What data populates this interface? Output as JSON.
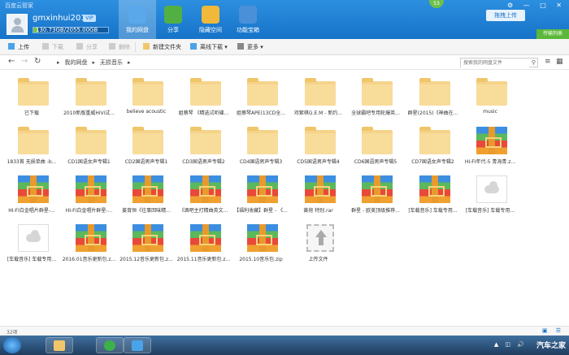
{
  "app": {
    "title": "百度云管家"
  },
  "user": {
    "name": "gmxinhui2014",
    "vip": "VIP",
    "quota_text": "130.73GB/2055.00GB",
    "quota_used": 0.0636
  },
  "nav": [
    {
      "label": "我的网盘",
      "color": "#5aa7ea",
      "active": true
    },
    {
      "label": "分享",
      "color": "#52b043",
      "active": false
    },
    {
      "label": "隐藏空间",
      "color": "#f0b93a",
      "active": false
    },
    {
      "label": "功能宝箱",
      "color": "#4a90d9",
      "active": false
    }
  ],
  "update_badge": "53",
  "drag_upload": "拖拽上传",
  "transfer_list": "传输列表",
  "toolbar": {
    "upload": "上传",
    "download": "下载",
    "share": "分享",
    "delete": "删除",
    "new_folder": "新建文件夹",
    "offline_download": "离线下载",
    "more": "更多"
  },
  "breadcrumb": [
    "我的网盘",
    "无损音乐"
  ],
  "search": {
    "placeholder": "搜索我的网盘文件"
  },
  "files": [
    {
      "name": "已下载",
      "type": "folder"
    },
    {
      "name": "2010新版重威HiVi试...",
      "type": "folder"
    },
    {
      "name": "believe acoustic",
      "type": "folder"
    },
    {
      "name": "姐蔡琴 《精选试听碟...",
      "type": "folder"
    },
    {
      "name": "姐蔡琴APE(13CD全...",
      "type": "folder"
    },
    {
      "name": "邓紫棋G.E.M - 新约...",
      "type": "folder"
    },
    {
      "name": "全球霸吧专用轮爆英...",
      "type": "folder"
    },
    {
      "name": "群星(2015)《神曲在...",
      "type": "folder"
    },
    {
      "name": "music",
      "type": "folder"
    },
    {
      "name": "1833首 无损单曲 -b...",
      "type": "folder"
    },
    {
      "name": "CD1国语女声专辑1",
      "type": "folder"
    },
    {
      "name": "CD2国语男声专辑1",
      "type": "folder"
    },
    {
      "name": "CD3国语男声专辑2",
      "type": "folder"
    },
    {
      "name": "CD4国语男声专辑3",
      "type": "folder"
    },
    {
      "name": "CD5国语男声专辑4",
      "type": "folder"
    },
    {
      "name": "CD6国语男声专辑5",
      "type": "folder"
    },
    {
      "name": "CD7国语女声专辑2",
      "type": "folder"
    },
    {
      "name": "HI-FI年代-5 青海青.z...",
      "type": "rar"
    },
    {
      "name": "HI-FI白金唱片群星-...",
      "type": "rar"
    },
    {
      "name": "HI-FI白金唱片群星-...",
      "type": "rar"
    },
    {
      "name": "姜育恒《往事回味精...",
      "type": "rar"
    },
    {
      "name": "《酒吧主打精曲英文...",
      "type": "rar"
    },
    {
      "name": "【福利收藏】群星 - 《...",
      "type": "rar"
    },
    {
      "name": "黄袍  特别.rar",
      "type": "rar"
    },
    {
      "name": "群星 - 欧美顶级推荐...",
      "type": "rar"
    },
    {
      "name": "[车载音乐] 车载专用...",
      "type": "rar"
    },
    {
      "name": "[车载音乐] 车载专用...",
      "type": "cloud"
    },
    {
      "name": "[车载音乐] 车载专用...",
      "type": "cloud"
    },
    {
      "name": "2016.01音乐更新包.z...",
      "type": "rar"
    },
    {
      "name": "2015.12音乐更新包.z...",
      "type": "rar"
    },
    {
      "name": "2015.11音乐更新包.z...",
      "type": "rar"
    },
    {
      "name": "2015.10音乐包.zip",
      "type": "rar"
    },
    {
      "name": "上传文件",
      "type": "upload"
    }
  ],
  "status": {
    "count": "32项"
  },
  "watermark": "汽车之家"
}
